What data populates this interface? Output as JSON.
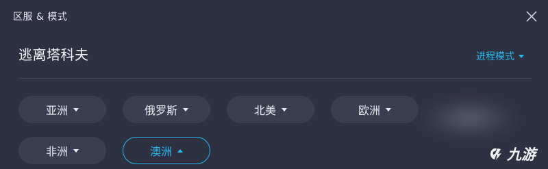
{
  "dialog": {
    "title": "区服 & 模式"
  },
  "game": {
    "name": "逃离塔科夫"
  },
  "mode": {
    "label": "进程模式"
  },
  "regions": [
    {
      "label": "亚洲",
      "active": false
    },
    {
      "label": "俄罗斯",
      "active": false
    },
    {
      "label": "北美",
      "active": false
    },
    {
      "label": "欧洲",
      "active": false
    },
    {
      "label": "非洲",
      "active": false
    },
    {
      "label": "澳洲",
      "active": true
    }
  ],
  "watermark": {
    "text": "九游"
  },
  "colors": {
    "background": "#2e3142",
    "button": "#3a3e51",
    "accent": "#28b8ef",
    "divider": "#41455a"
  },
  "icons": {
    "close": "close-icon",
    "dropdown": "chevron-down-icon",
    "collapse": "chevron-up-icon"
  }
}
